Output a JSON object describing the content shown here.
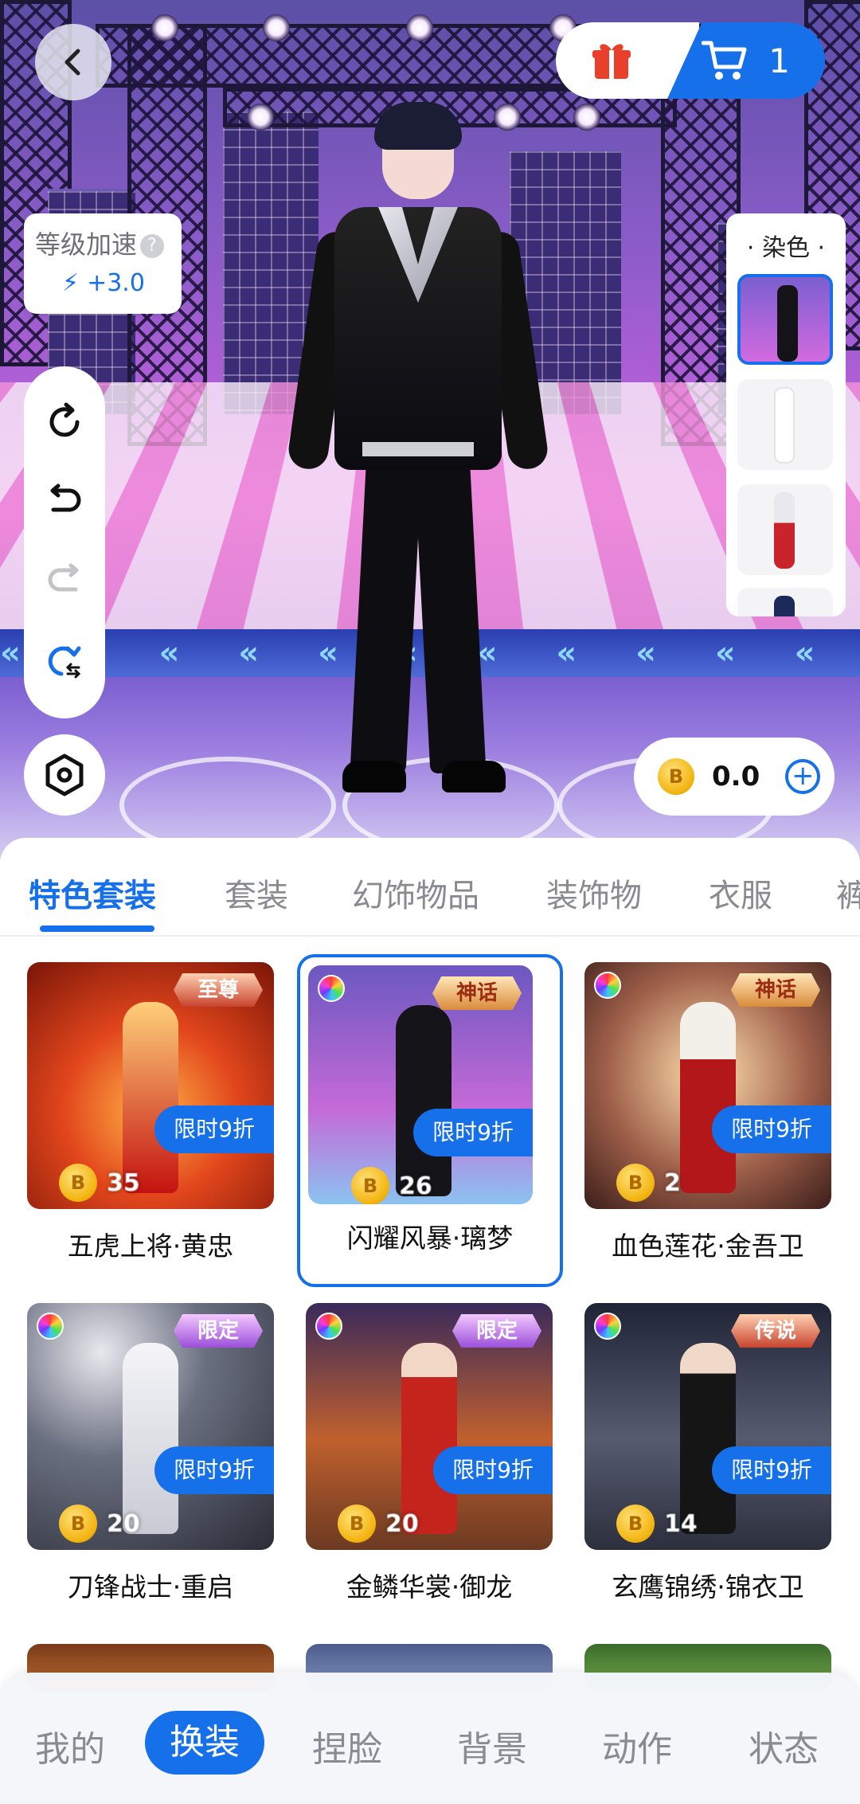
{
  "top_bar": {
    "back_icon": "back-arrow-icon",
    "gift_icon": "gift-icon",
    "cart_icon": "cart-icon",
    "cart_count": "1"
  },
  "level_boost": {
    "label": "等级加速",
    "help_icon": "question-icon",
    "bolt_icon": "lightning-icon",
    "value": "+3.0"
  },
  "toolbar": {
    "icons": [
      "refresh-icon",
      "undo-icon",
      "redo-icon",
      "reset-pose-icon"
    ],
    "settings_icon": "hexagon-settings-icon"
  },
  "dye_panel": {
    "title": "· 染色 ·",
    "thumbnail_count": 4
  },
  "coins": {
    "amount": "0.0",
    "add_icon": "plus-icon",
    "coin_icon": "coin-icon",
    "coin_glyph": "B"
  },
  "tabs": [
    {
      "label": "特色套装",
      "active": true
    },
    {
      "label": "套装",
      "active": false
    },
    {
      "label": "幻饰物品",
      "active": false
    },
    {
      "label": "装饰物",
      "active": false
    },
    {
      "label": "衣服",
      "active": false
    },
    {
      "label": "裤",
      "active": false
    }
  ],
  "items": [
    {
      "name": "五虎上将·黄忠",
      "rarity": "至尊",
      "discount": "限时9折",
      "price": "35",
      "dye": false,
      "selected": false
    },
    {
      "name": "闪耀风暴·璃梦",
      "rarity": "神话",
      "discount": "限时9折",
      "price": "26",
      "dye": true,
      "selected": true
    },
    {
      "name": "血色莲花·金吾卫",
      "rarity": "神话",
      "discount": "限时9折",
      "price": "2",
      "dye": true,
      "selected": false
    },
    {
      "name": "刀锋战士·重启",
      "rarity": "限定",
      "discount": "限时9折",
      "price": "20",
      "dye": true,
      "selected": false
    },
    {
      "name": "金鳞华裳·御龙",
      "rarity": "限定",
      "discount": "限时9折",
      "price": "20",
      "dye": true,
      "selected": false
    },
    {
      "name": "玄鹰锦绣·锦衣卫",
      "rarity": "传说",
      "discount": "限时9折",
      "price": "14",
      "dye": true,
      "selected": false
    }
  ],
  "bottom_nav": [
    {
      "label": "我的",
      "active": false
    },
    {
      "label": "换装",
      "active": true
    },
    {
      "label": "捏脸",
      "active": false
    },
    {
      "label": "背景",
      "active": false
    },
    {
      "label": "动作",
      "active": false
    },
    {
      "label": "状态",
      "active": false
    }
  ],
  "colors": {
    "accent": "#1670ea",
    "gift": "#e8402a"
  }
}
